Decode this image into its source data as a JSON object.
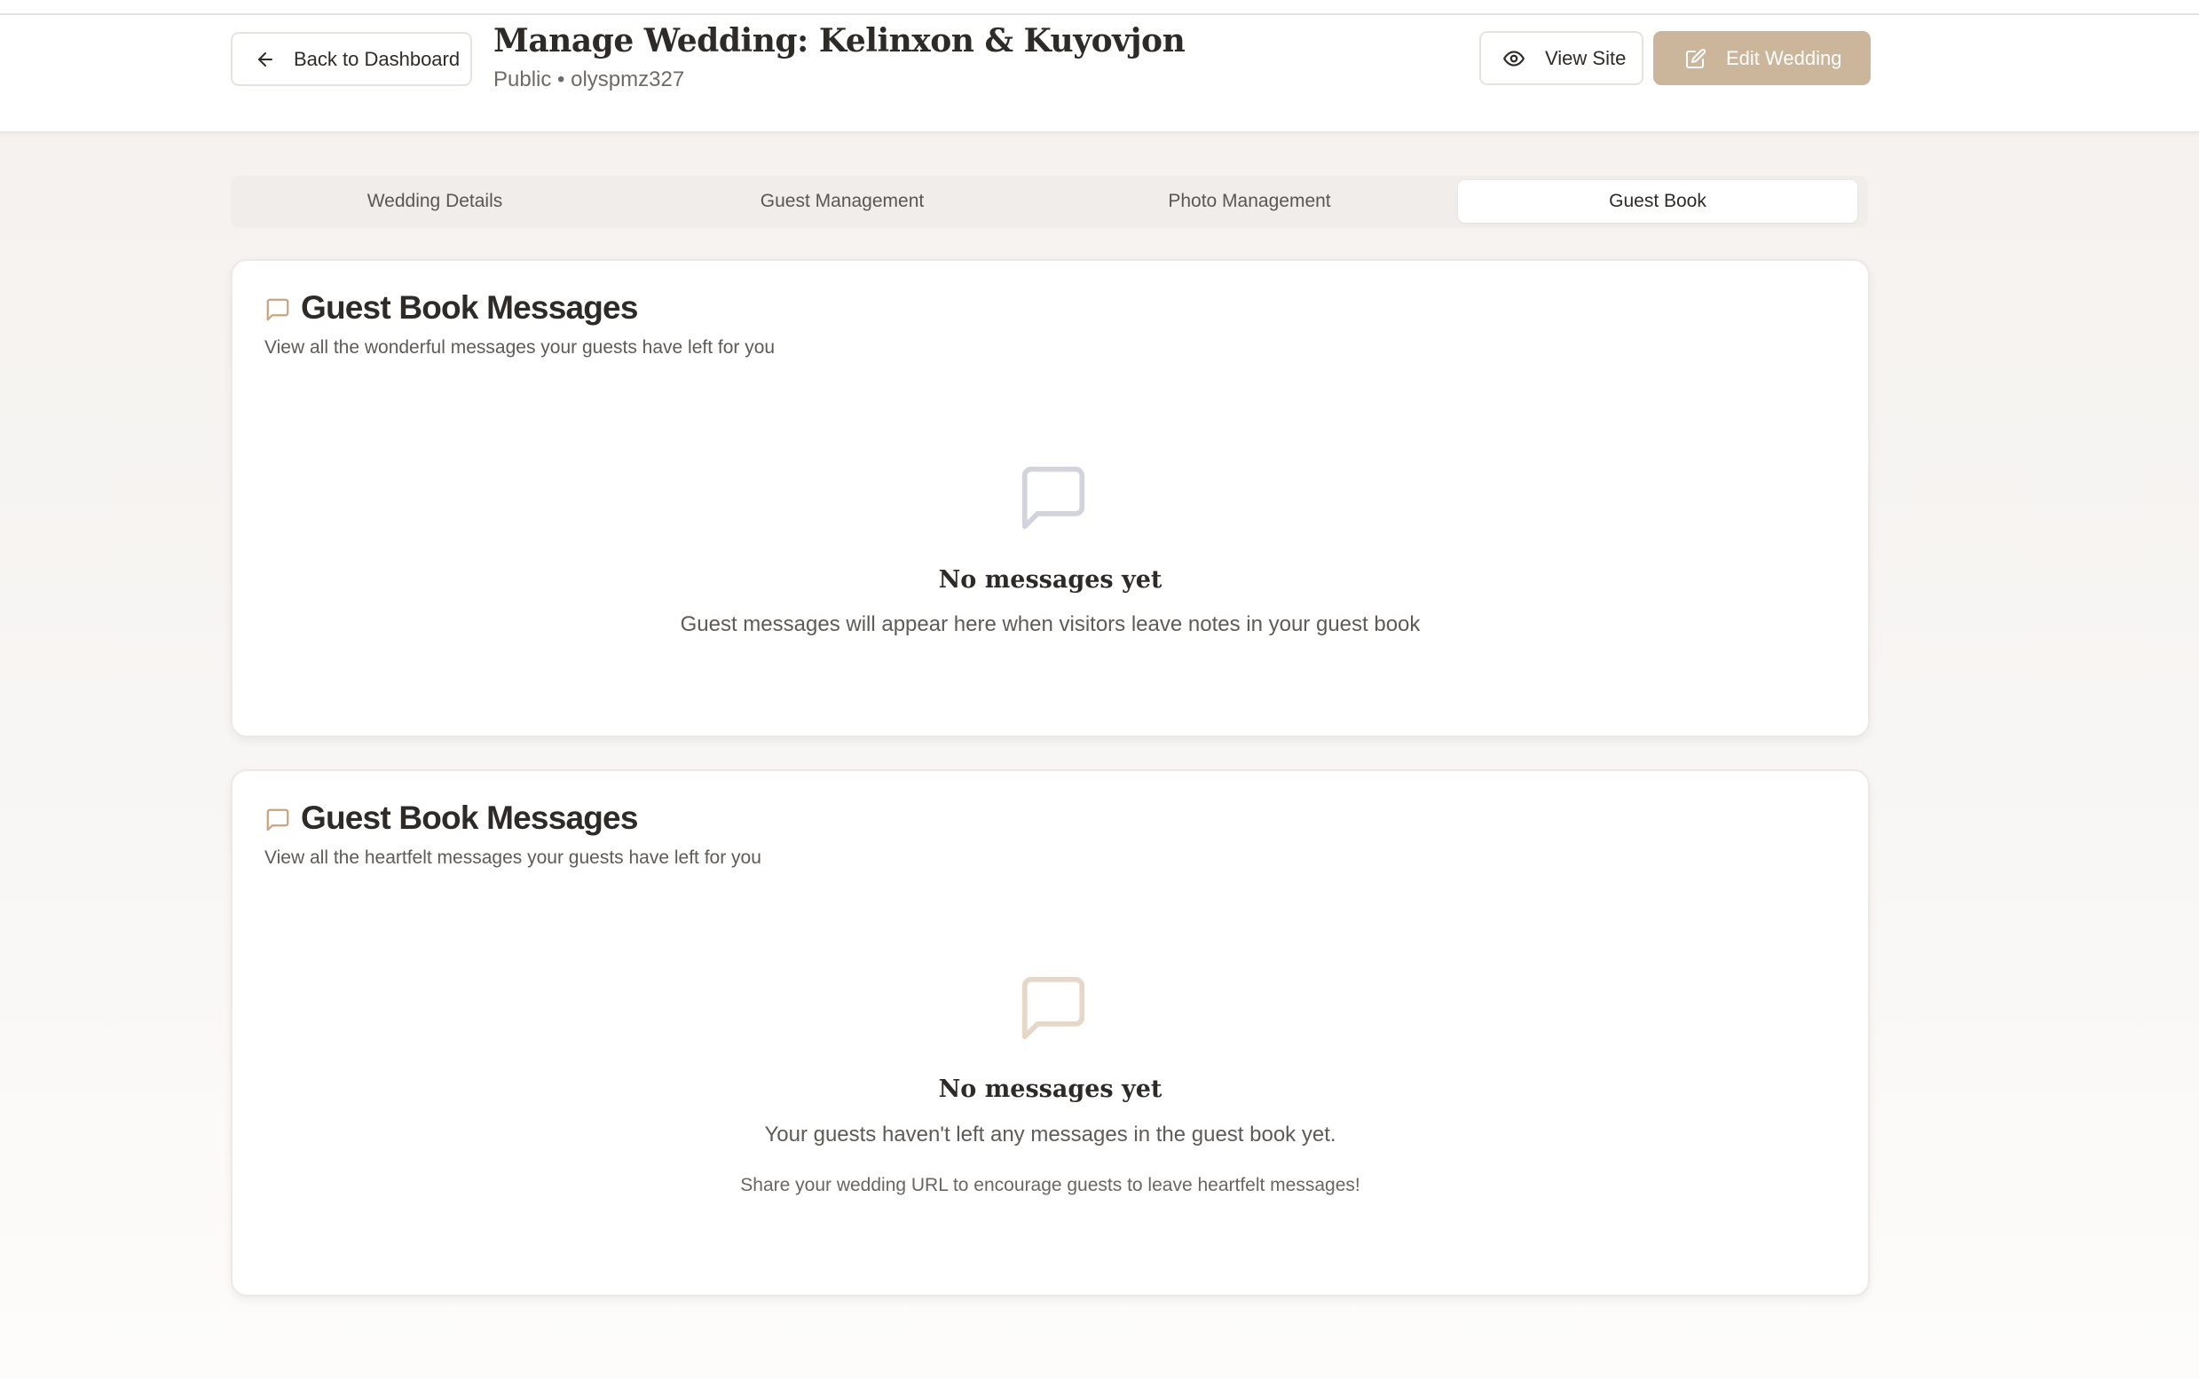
{
  "header": {
    "back_label": "Back to Dashboard",
    "title": "Manage Wedding: Kelinxon & Kuyovjon",
    "subtitle": "Public • olyspmz327",
    "view_site_label": "View Site",
    "edit_wedding_label": "Edit Wedding",
    "accent_color": "#cbb59b"
  },
  "tabs": [
    {
      "label": "Wedding Details",
      "active": false
    },
    {
      "label": "Guest Management",
      "active": false
    },
    {
      "label": "Photo Management",
      "active": false
    },
    {
      "label": "Guest Book",
      "active": true
    }
  ],
  "cards": [
    {
      "icon": "message-square-icon",
      "title": "Guest Book Messages",
      "subtitle": "View all the wonderful messages your guests have left for you",
      "empty": {
        "icon": "message-square-icon",
        "icon_color": "#d1d5db",
        "title": "No messages yet",
        "text": "Guest messages will appear here when visitors leave notes in your guest book"
      }
    },
    {
      "icon": "message-square-icon",
      "title": "Guest Book Messages",
      "subtitle": "View all the heartfelt messages your guests have left for you",
      "empty": {
        "icon": "message-square-icon",
        "icon_color": "#e6d7c7",
        "title": "No messages yet",
        "text": "Your guests haven't left any messages in the guest book yet.",
        "note": "Share your wedding URL to encourage guests to leave heartfelt messages!"
      }
    }
  ]
}
